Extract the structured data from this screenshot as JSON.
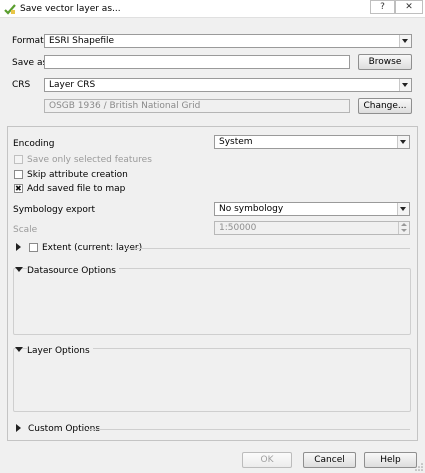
{
  "window": {
    "title": "Save vector layer as...",
    "help_glyph": "?",
    "close_glyph": "✕"
  },
  "form": {
    "format_label": "Format",
    "format_value": "ESRI Shapefile",
    "save_as_label": "Save as",
    "save_as_value": "",
    "browse_label": "Browse",
    "crs_label": "CRS",
    "crs_value": "Layer CRS",
    "crs_name": "OSGB 1936 / British National Grid",
    "change_label": "Change..."
  },
  "options": {
    "encoding_label": "Encoding",
    "encoding_value": "System",
    "save_selected_label": "Save only selected features",
    "skip_attr_label": "Skip attribute creation",
    "add_to_map_label": "Add saved file to map",
    "symbology_label": "Symbology export",
    "symbology_value": "No symbology",
    "scale_label": "Scale",
    "scale_value": "1:50000",
    "extent_label": "Extent (current: layer)",
    "datasource_label": "Datasource Options",
    "layer_options_label": "Layer Options",
    "custom_options_label": "Custom Options"
  },
  "buttons": {
    "ok": "OK",
    "cancel": "Cancel",
    "help": "Help"
  }
}
